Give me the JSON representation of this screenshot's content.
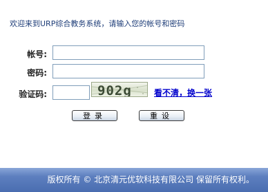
{
  "welcome_text": "欢迎来到URP综合教务系统，请输入您的帐号和密码",
  "form": {
    "account_label": "帐号:",
    "account_value": "",
    "password_label": "密码:",
    "password_value": "",
    "captcha_label": "验证码:",
    "captcha_value": "",
    "captcha_image_text": "902g",
    "refresh_link": "看不清，换一张"
  },
  "buttons": {
    "login": "登录",
    "reset": "重设"
  },
  "footer": {
    "text": "版权所有 © 北京清元优软科技有限公司 保留所有权利。"
  }
}
